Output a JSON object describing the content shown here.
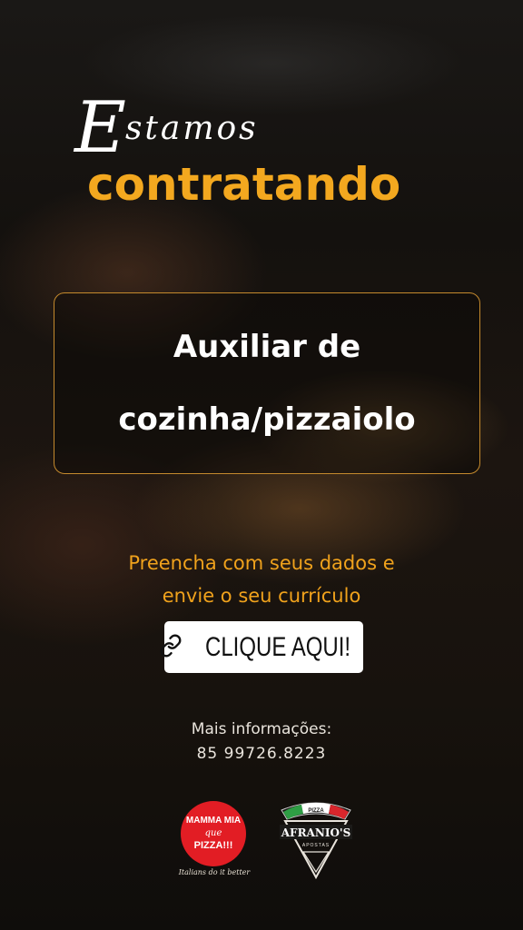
{
  "hero": {
    "script_cap": "E",
    "script_rest": "stamos",
    "main": "contratando"
  },
  "job": {
    "title": "Auxiliar de\ncozinha/pizzaiolo"
  },
  "cta": {
    "text": "Preencha com seus dados e\nenvie o seu currículo",
    "button_label": "CLIQUE AQUI!",
    "button_icon": "link-icon"
  },
  "info": {
    "label": "Mais informações:",
    "phone": "85 99726.8223"
  },
  "logos": {
    "mamma_mia": {
      "line1": "MAMMA MIA",
      "line2": "que",
      "line3": "PIZZA!!!",
      "tagline": "Italians do it better",
      "color": "#e21d24"
    },
    "afranio": {
      "top": "PIZZA",
      "name": "AFRANIO'S",
      "bottom": "APOSTAS",
      "flag_colors": [
        "#2e9e44",
        "#ffffff",
        "#d8262c"
      ]
    }
  },
  "colors": {
    "accent": "#f3a81f",
    "box_border": "#c58a2d"
  }
}
